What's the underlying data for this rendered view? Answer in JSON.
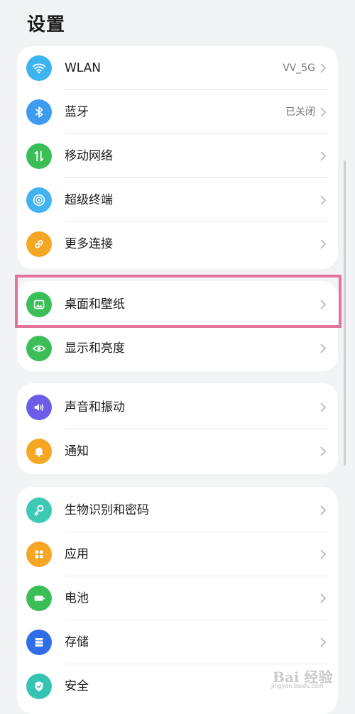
{
  "header": {
    "title": "设置"
  },
  "colors": {
    "wlan": "#3db4ef",
    "bluetooth": "#3d9cf0",
    "mobile": "#3bbd57",
    "super": "#41b3ef",
    "connect": "#f5a623",
    "desktop": "#3bbd57",
    "display": "#3bbd57",
    "sound": "#6d5ce8",
    "notify": "#f5a623",
    "bio": "#3ec9b5",
    "apps": "#f5a623",
    "battery": "#3bbd57",
    "storage": "#2f6ee8",
    "security": "#35c3b2",
    "highlight": "#e3749b"
  },
  "groups": [
    {
      "items": [
        {
          "icon": "wifi-icon",
          "label": "WLAN",
          "value": "VV_5G"
        },
        {
          "icon": "bluetooth-icon",
          "label": "蓝牙",
          "value": "已关闭"
        },
        {
          "icon": "mobile-network-icon",
          "label": "移动网络",
          "value": ""
        },
        {
          "icon": "super-device-icon",
          "label": "超级终端",
          "value": ""
        },
        {
          "icon": "link-icon",
          "label": "更多连接",
          "value": ""
        }
      ]
    },
    {
      "items": [
        {
          "icon": "wallpaper-icon",
          "label": "桌面和壁纸",
          "value": ""
        },
        {
          "icon": "eye-icon",
          "label": "显示和亮度",
          "value": ""
        }
      ]
    },
    {
      "items": [
        {
          "icon": "speaker-icon",
          "label": "声音和振动",
          "value": ""
        },
        {
          "icon": "bell-icon",
          "label": "通知",
          "value": ""
        }
      ]
    },
    {
      "items": [
        {
          "icon": "key-icon",
          "label": "生物识别和密码",
          "value": ""
        },
        {
          "icon": "apps-grid-icon",
          "label": "应用",
          "value": ""
        },
        {
          "icon": "battery-icon",
          "label": "电池",
          "value": ""
        },
        {
          "icon": "storage-icon",
          "label": "存储",
          "value": ""
        },
        {
          "icon": "shield-icon",
          "label": "安全",
          "value": ""
        }
      ]
    }
  ],
  "watermark": {
    "text": "Bai 经验",
    "sub": "jingyan.baidu.com"
  }
}
